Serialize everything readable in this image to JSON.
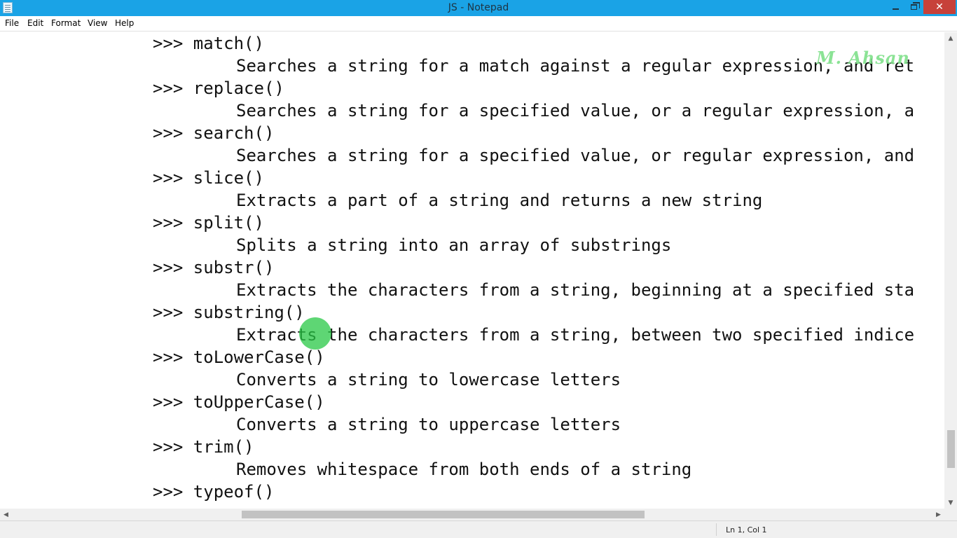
{
  "window": {
    "title": "JS - Notepad",
    "close_glyph": "✕"
  },
  "menu": [
    "File",
    "Edit",
    "Format",
    "View",
    "Help"
  ],
  "editor": {
    "lines": [
      ">>> match()",
      "Searches a string for a match against a regular expression, and ret",
      ">>> replace()",
      "Searches a string for a specified value, or a regular expression, a",
      ">>> search()",
      "Searches a string for a specified value, or regular expression, and",
      ">>> slice()",
      "Extracts a part of a string and returns a new string",
      ">>> split()",
      "Splits a string into an array of substrings",
      ">>> substr()",
      "Extracts the characters from a string, beginning at a specified sta",
      ">>> substring()",
      "Extracts the characters from a string, between two specified indice",
      ">>> toLowerCase()",
      "Converts a string to lowercase letters",
      ">>> toUpperCase()",
      "Converts a string to uppercase letters",
      ">>> trim()",
      "Removes whitespace from both ends of a string",
      ">>> typeof()"
    ],
    "watermark": "M. Ahsan"
  },
  "scrollbars": {
    "up": "▲",
    "down": "▼",
    "left": "◀",
    "right": "▶"
  },
  "status": {
    "position": "Ln 1, Col 1"
  },
  "colors": {
    "titlebar": "#1aa3e6",
    "close": "#c7413a",
    "highlight": "#28c846"
  }
}
